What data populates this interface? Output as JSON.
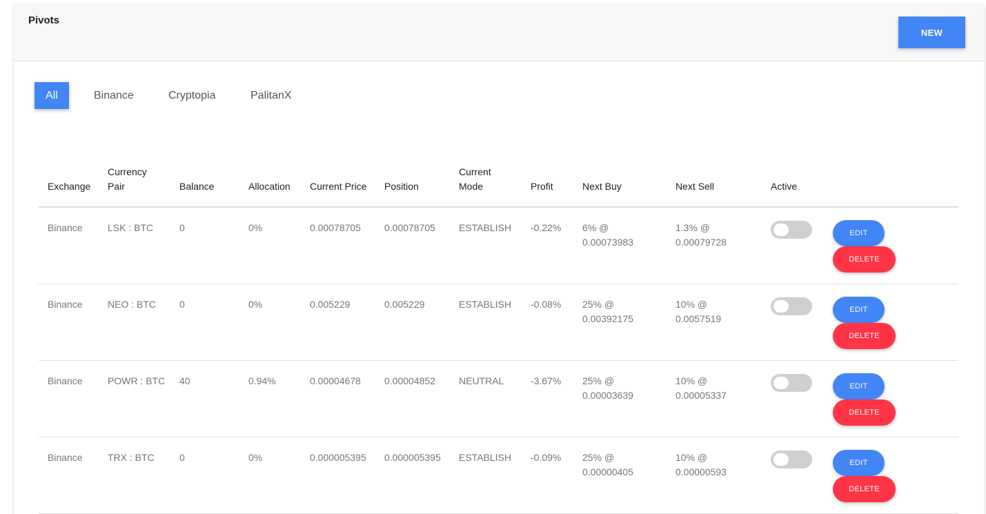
{
  "header": {
    "title": "Pivots",
    "new_label": "NEW"
  },
  "tabs": [
    {
      "label": "All",
      "active": true
    },
    {
      "label": "Binance",
      "active": false
    },
    {
      "label": "Cryptopia",
      "active": false
    },
    {
      "label": "PalitanX",
      "active": false
    }
  ],
  "table": {
    "columns": [
      "Exchange",
      "Currency Pair",
      "Balance",
      "Allocation",
      "Current Price",
      "Position",
      "Current Mode",
      "Profit",
      "Next Buy",
      "Next Sell",
      "Active"
    ],
    "rows": [
      {
        "exchange": "Binance",
        "pair": "LSK : BTC",
        "balance": "0",
        "allocation": "0%",
        "current_price": "0.00078705",
        "position": "0.00078705",
        "mode": "ESTABLISH",
        "profit": "-0.22%",
        "next_buy_pct": "6% @",
        "next_buy_price": "0.00073983",
        "next_sell_pct": "1.3% @",
        "next_sell_price": "0.00079728",
        "active": false
      },
      {
        "exchange": "Binance",
        "pair": "NEO : BTC",
        "balance": "0",
        "allocation": "0%",
        "current_price": "0.005229",
        "position": "0.005229",
        "mode": "ESTABLISH",
        "profit": "-0.08%",
        "next_buy_pct": "25% @",
        "next_buy_price": "0.00392175",
        "next_sell_pct": "10% @",
        "next_sell_price": "0.0057519",
        "active": false
      },
      {
        "exchange": "Binance",
        "pair": "POWR : BTC",
        "balance": "40",
        "allocation": "0.94%",
        "current_price": "0.00004678",
        "position": "0.00004852",
        "mode": "NEUTRAL",
        "profit": "-3.67%",
        "next_buy_pct": "25% @",
        "next_buy_price": "0.00003639",
        "next_sell_pct": "10% @",
        "next_sell_price": "0.00005337",
        "active": false
      },
      {
        "exchange": "Binance",
        "pair": "TRX : BTC",
        "balance": "0",
        "allocation": "0%",
        "current_price": "0.000005395",
        "position": "0.000005395",
        "mode": "ESTABLISH",
        "profit": "-0.09%",
        "next_buy_pct": "25% @",
        "next_buy_price": "0.00000405",
        "next_sell_pct": "10% @",
        "next_sell_price": "0.00000593",
        "active": false
      }
    ],
    "edit_label": "EDIT",
    "delete_label": "DELETE"
  },
  "colors": {
    "primary": "#4285f4",
    "danger": "#ff3547",
    "header_bg": "#f7f7f7",
    "toggle_off": "#cfcfcf"
  }
}
